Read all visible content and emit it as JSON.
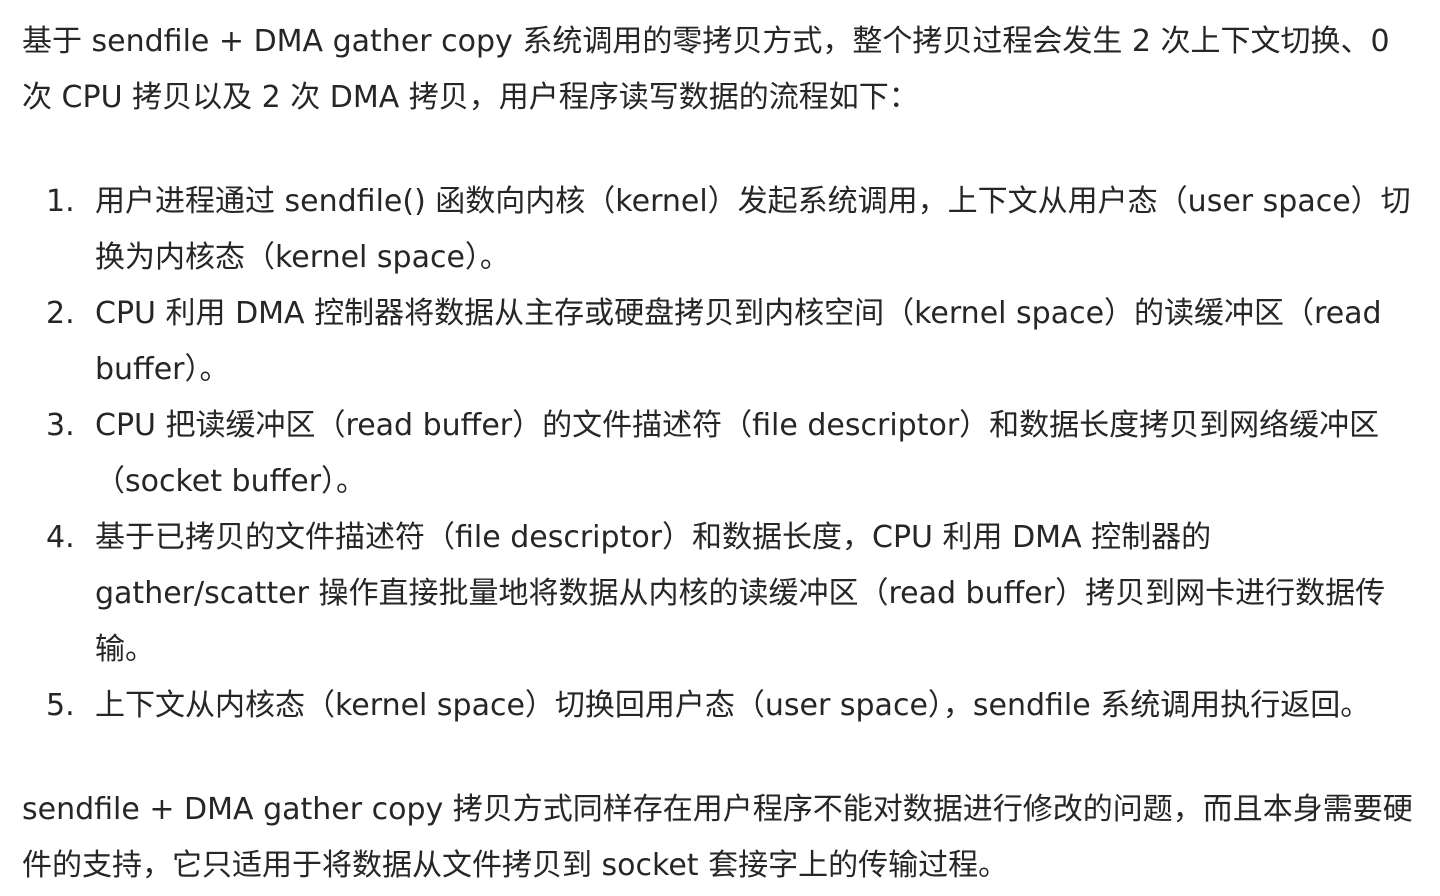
{
  "intro": "基于 sendfile + DMA gather copy 系统调用的零拷贝方式，整个拷贝过程会发生 2 次上下文切换、0 次 CPU 拷贝以及 2 次 DMA 拷贝，用户程序读写数据的流程如下：",
  "steps": [
    {
      "num": "1.",
      "text": "用户进程通过 sendfile() 函数向内核（kernel）发起系统调用，上下文从用户态（user space）切换为内核态（kernel space）。"
    },
    {
      "num": "2.",
      "text": "CPU 利用 DMA 控制器将数据从主存或硬盘拷贝到内核空间（kernel space）的读缓冲区（read buffer）。"
    },
    {
      "num": "3.",
      "text": "CPU 把读缓冲区（read buffer）的文件描述符（file descriptor）和数据长度拷贝到网络缓冲区（socket buffer）。"
    },
    {
      "num": "4.",
      "text": "基于已拷贝的文件描述符（file descriptor）和数据长度，CPU 利用 DMA 控制器的 gather/scatter 操作直接批量地将数据从内核的读缓冲区（read buffer）拷贝到网卡进行数据传输。"
    },
    {
      "num": "5.",
      "text": "上下文从内核态（kernel space）切换回用户态（user space），sendfile 系统调用执行返回。"
    }
  ],
  "outro": "sendfile + DMA gather copy 拷贝方式同样存在用户程序不能对数据进行修改的问题，而且本身需要硬件的支持，它只适用于将数据从文件拷贝到 socket 套接字上的传输过程。"
}
